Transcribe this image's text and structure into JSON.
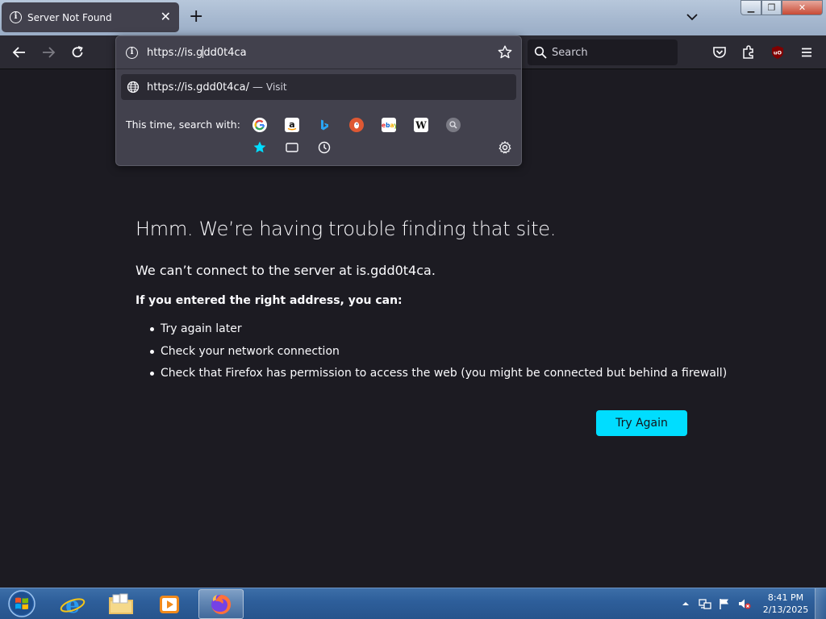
{
  "browser": {
    "tab": {
      "title": "Server Not Found"
    },
    "url": {
      "typed_before_caret": "https://is.g",
      "typed_after_caret": "dd0t4ca"
    },
    "search": {
      "placeholder": "Search"
    }
  },
  "urlbar_popup": {
    "suggestion": {
      "url": "https://is.gdd0t4ca/",
      "dash": "—",
      "action": "Visit"
    },
    "search_with_label": "This time, search with:",
    "engines": [
      "google",
      "amazon",
      "bing",
      "duckduckgo",
      "ebay",
      "wikipedia",
      "search"
    ]
  },
  "error_page": {
    "title": "Hmm. We’re having trouble finding that site.",
    "subtitle": "We can’t connect to the server at is.gdd0t4ca.",
    "advice_heading": "If you entered the right address, you can:",
    "suggestions": [
      "Try again later",
      "Check your network connection",
      "Check that Firefox has permission to access the web (you might be connected but behind a firewall)"
    ],
    "try_again_label": "Try Again"
  },
  "taskbar": {
    "time": "8:41 PM",
    "date": "2/13/2025"
  },
  "colors": {
    "page_bg": "#1c1b22",
    "toolbar_bg": "#2b2a33",
    "popup_bg": "#42414d",
    "accent": "#00ddff"
  }
}
